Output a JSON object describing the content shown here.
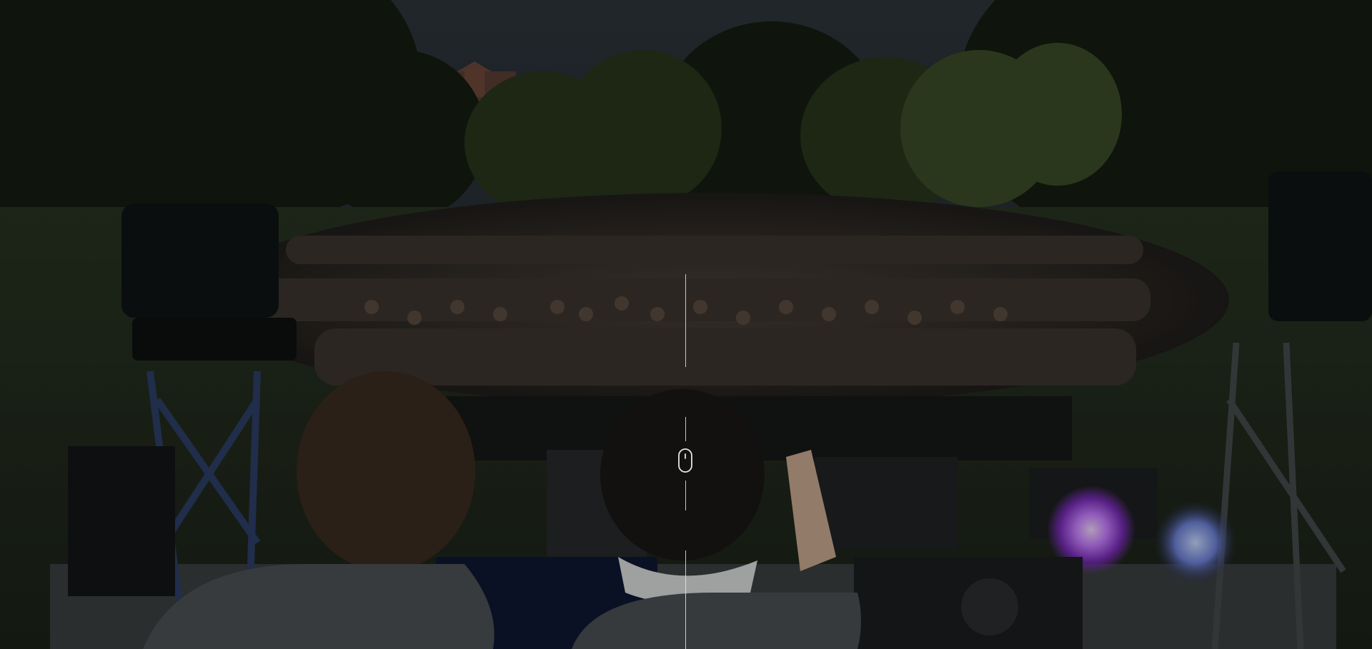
{
  "hero": {
    "image_icon": "concert-stage-crowd-photo",
    "overlay_color": "#050608",
    "accent_light_color": "#c77dff"
  },
  "scroll_indicator": {
    "icon": "mouse-scroll-icon",
    "line_color": "#e6e6e6"
  }
}
